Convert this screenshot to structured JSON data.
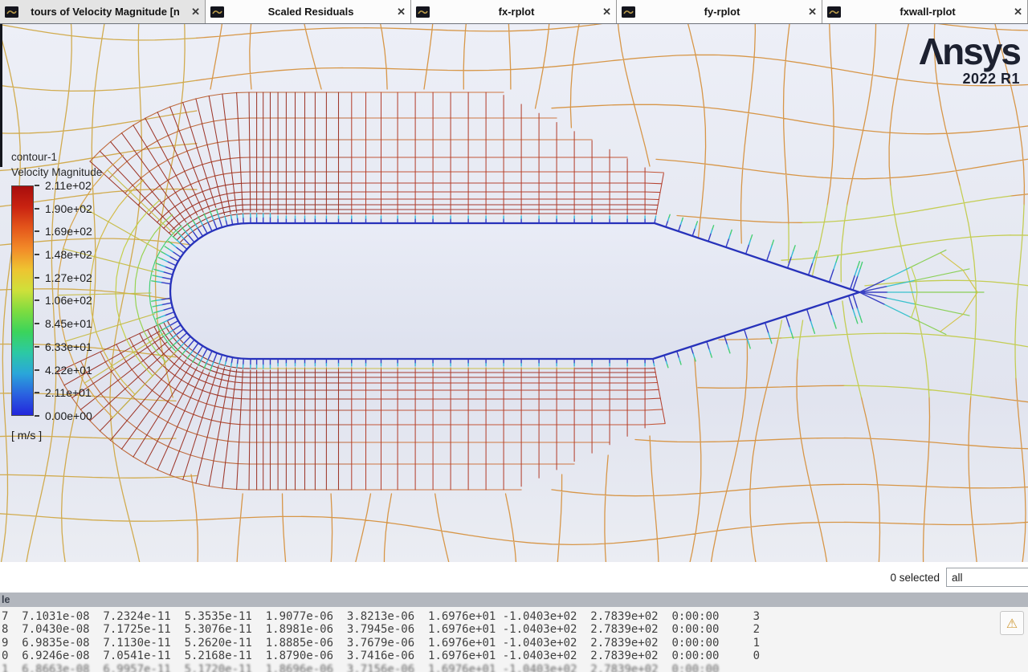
{
  "tab_close": "✕",
  "tabs": [
    {
      "label": "tours of Velocity Magnitude [n",
      "active": true
    },
    {
      "label": "Scaled Residuals",
      "active": false
    },
    {
      "label": "fx-rplot",
      "active": false
    },
    {
      "label": "fy-rplot",
      "active": false
    },
    {
      "label": "fxwall-rplot",
      "active": false
    }
  ],
  "logo": {
    "brand": "Λnsys",
    "version": "2022 R1"
  },
  "legend": {
    "name": "contour-1",
    "field": "Velocity Magnitude",
    "unit": "[ m/s ]",
    "levels": [
      "2.11e+02",
      "1.90e+02",
      "1.69e+02",
      "1.48e+02",
      "1.27e+02",
      "1.06e+02",
      "8.45e+01",
      "6.33e+01",
      "4.22e+01",
      "2.11e+01",
      "0.00e+00"
    ],
    "gradient": [
      "#a80d0d",
      "#c92311",
      "#e4561b",
      "#f28a28",
      "#eec431",
      "#cfe03a",
      "#7edc40",
      "#3bd45b",
      "#2cc9a4",
      "#2aa6da",
      "#2a62e0",
      "#2326dc"
    ]
  },
  "status": {
    "selected_text": "0 selected",
    "filter_value": "all"
  },
  "console": {
    "header": "le",
    "warning_icon": "⚠",
    "rows": [
      "7  7.1031e-08  7.2324e-11  5.3535e-11  1.9077e-06  3.8213e-06  1.6976e+01 -1.0403e+02  2.7839e+02  0:00:00     3",
      "8  7.0430e-08  7.1725e-11  5.3076e-11  1.8981e-06  3.7945e-06  1.6976e+01 -1.0403e+02  2.7839e+02  0:00:00     2",
      "9  6.9835e-08  7.1130e-11  5.2620e-11  1.8885e-06  3.7679e-06  1.6976e+01 -1.0403e+02  2.7839e+02  0:00:00     1",
      "0  6.9246e-08  7.0541e-11  5.2168e-11  1.8790e-06  3.7416e-06  1.6976e+01 -1.0403e+02  2.7839e+02  0:00:00     0"
    ],
    "partial_row": "1  6.8663e-08  6.9957e-11  5.1720e-11  1.8696e-06  3.7156e-06  1.6976e+01 -1.0403e+02  2.7839e+02  0:00:00"
  },
  "mesh_palette": {
    "farfield": "#d6913e",
    "farfield_gold": "#d0a846",
    "wake": "#c2cb4b",
    "band_dark": [
      "#8f2a1f",
      "#9e3122",
      "#ad4429",
      "#bc6232"
    ],
    "band": [
      "#a23226",
      "#b23a28",
      "#c14e2e",
      "#cd6f37"
    ],
    "band_column": "#b23a27",
    "band_column_dark": "#9a2e21",
    "band_yellow": "#c9bc3e",
    "wall": "#2a33c2",
    "wall_tip": "#2bb7d4",
    "wall_green": "#3fce6e",
    "fan_rows": [
      "#3ecf6e",
      "#92d24a",
      "#c2ce41",
      "#d2b83f",
      "#d6a040"
    ],
    "fan_radial": "#c6bc46",
    "tail_ray": [
      "#2f38c0",
      "#2fbfca",
      "#86cf4f"
    ],
    "tail_arc1": "#c0d24a",
    "tail_arc2": "#d2c243",
    "body_fill_top": "#e9ecf6",
    "body_fill_bottom": "#dde1ee",
    "body_outline": "#2732ba"
  }
}
